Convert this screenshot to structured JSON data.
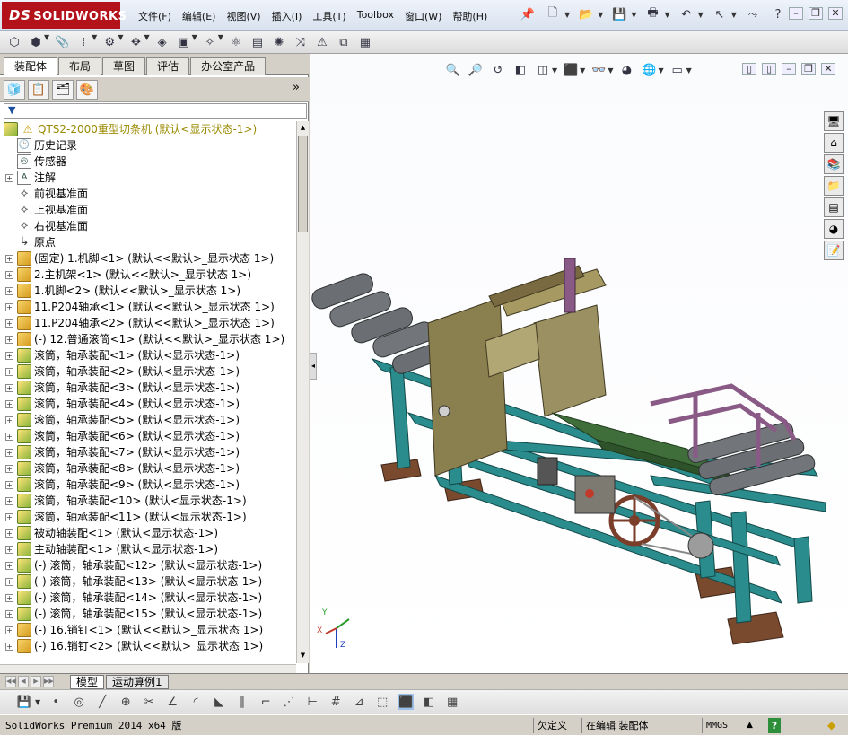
{
  "app": {
    "logo_text": "SOLIDWORKS",
    "logo_mark": "DS"
  },
  "menu": [
    "文件(F)",
    "编辑(E)",
    "视图(V)",
    "插入(I)",
    "工具(T)",
    "Toolbox",
    "窗口(W)",
    "帮助(H)"
  ],
  "command_tabs": [
    "装配体",
    "布局",
    "草图",
    "评估",
    "办公室产品"
  ],
  "tree": {
    "root": "QTS2-2000重型切条机  (默认<显示状态-1>)",
    "items": [
      {
        "label": "历史记录",
        "icon": "history-icon",
        "exp": false
      },
      {
        "label": "传感器",
        "icon": "sensor-icon",
        "exp": false
      },
      {
        "label": "注解",
        "icon": "annotation-icon",
        "exp": true
      },
      {
        "label": "前视基准面",
        "icon": "plane-icon",
        "exp": false
      },
      {
        "label": "上视基准面",
        "icon": "plane-icon",
        "exp": false
      },
      {
        "label": "右视基准面",
        "icon": "plane-icon",
        "exp": false
      },
      {
        "label": "原点",
        "icon": "origin-icon",
        "exp": false
      },
      {
        "label": "(固定) 1.机脚<1> (默认<<默认>_显示状态 1>)",
        "icon": "part-icon",
        "exp": true
      },
      {
        "label": "2.主机架<1> (默认<<默认>_显示状态 1>)",
        "icon": "part-icon",
        "exp": true
      },
      {
        "label": "1.机脚<2> (默认<<默认>_显示状态 1>)",
        "icon": "part-icon",
        "exp": true
      },
      {
        "label": "11.P204轴承<1> (默认<<默认>_显示状态 1>)",
        "icon": "part-icon",
        "exp": true
      },
      {
        "label": "11.P204轴承<2> (默认<<默认>_显示状态 1>)",
        "icon": "part-icon",
        "exp": true
      },
      {
        "label": "(-) 12.普通滚筒<1> (默认<<默认>_显示状态 1>)",
        "icon": "part-icon",
        "exp": true
      },
      {
        "label": "滚筒，轴承装配<1> (默认<显示状态-1>)",
        "icon": "assembly-icon",
        "exp": true
      },
      {
        "label": "滚筒，轴承装配<2> (默认<显示状态-1>)",
        "icon": "assembly-icon",
        "exp": true
      },
      {
        "label": "滚筒，轴承装配<3> (默认<显示状态-1>)",
        "icon": "assembly-icon",
        "exp": true
      },
      {
        "label": "滚筒，轴承装配<4> (默认<显示状态-1>)",
        "icon": "assembly-icon",
        "exp": true
      },
      {
        "label": "滚筒，轴承装配<5> (默认<显示状态-1>)",
        "icon": "assembly-icon",
        "exp": true
      },
      {
        "label": "滚筒，轴承装配<6> (默认<显示状态-1>)",
        "icon": "assembly-icon",
        "exp": true
      },
      {
        "label": "滚筒，轴承装配<7> (默认<显示状态-1>)",
        "icon": "assembly-icon",
        "exp": true
      },
      {
        "label": "滚筒，轴承装配<8> (默认<显示状态-1>)",
        "icon": "assembly-icon",
        "exp": true
      },
      {
        "label": "滚筒，轴承装配<9> (默认<显示状态-1>)",
        "icon": "assembly-icon",
        "exp": true
      },
      {
        "label": "滚筒，轴承装配<10> (默认<显示状态-1>)",
        "icon": "assembly-icon",
        "exp": true
      },
      {
        "label": "滚筒，轴承装配<11> (默认<显示状态-1>)",
        "icon": "assembly-icon",
        "exp": true
      },
      {
        "label": "被动轴装配<1> (默认<显示状态-1>)",
        "icon": "assembly-icon",
        "exp": true
      },
      {
        "label": "主动轴装配<1> (默认<显示状态-1>)",
        "icon": "assembly-icon",
        "exp": true
      },
      {
        "label": "(-) 滚筒，轴承装配<12> (默认<显示状态-1>)",
        "icon": "assembly-icon",
        "exp": true
      },
      {
        "label": "(-) 滚筒，轴承装配<13> (默认<显示状态-1>)",
        "icon": "assembly-icon",
        "exp": true
      },
      {
        "label": "(-) 滚筒，轴承装配<14> (默认<显示状态-1>)",
        "icon": "assembly-icon",
        "exp": true
      },
      {
        "label": "(-) 滚筒，轴承装配<15> (默认<显示状态-1>)",
        "icon": "assembly-icon",
        "exp": true
      },
      {
        "label": "(-) 16.销钉<1> (默认<<默认>_显示状态 1>)",
        "icon": "part-icon",
        "exp": true
      },
      {
        "label": "(-) 16.销钉<2> (默认<<默认>_显示状态 1>)",
        "icon": "part-icon",
        "exp": true
      }
    ]
  },
  "model_tabs": [
    "模型",
    "运动算例1"
  ],
  "status": {
    "product": "SolidWorks Premium 2014 x64 版",
    "underdefined": "欠定义",
    "editing": "在编辑 装配体",
    "units": "MMGS",
    "up_arrow": "▲",
    "help": "?"
  },
  "triad": {
    "x": "X",
    "y": "Y",
    "z": "Z"
  },
  "colors": {
    "frame_teal": "#2a8c8c",
    "machine_olive": "#8a7f4e",
    "roller_gray": "#6b6f73",
    "belt_green": "#3f6e3a",
    "base_brown": "#7a4a2e",
    "guard_purple": "#8a5a86"
  }
}
